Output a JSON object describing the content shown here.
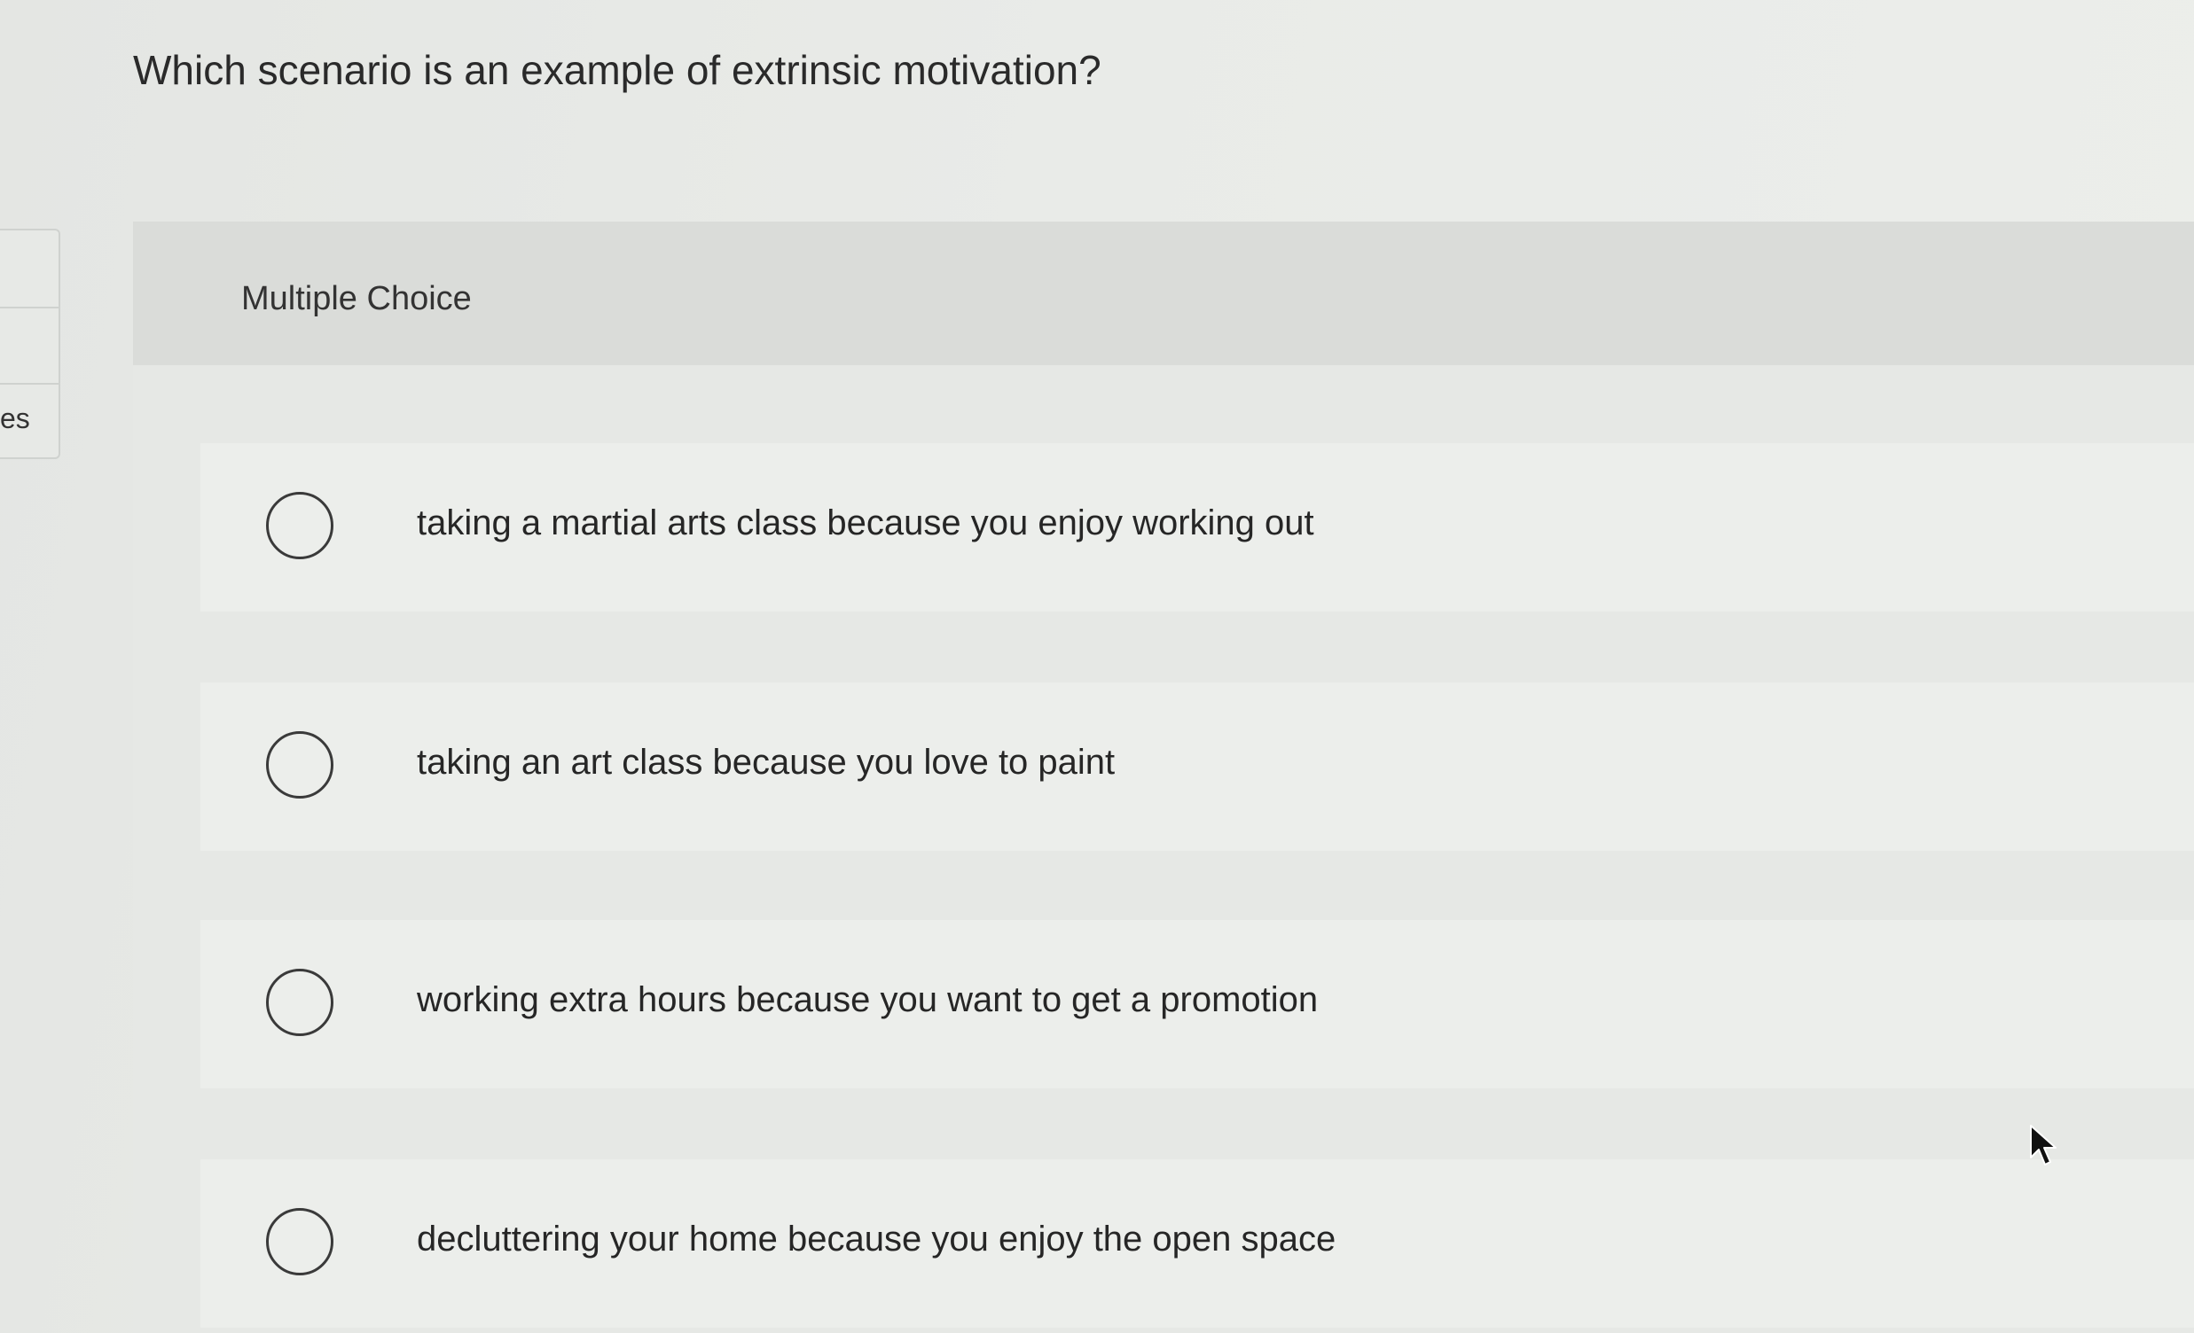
{
  "question": {
    "text": "Which scenario is an example of extrinsic motivation?"
  },
  "sidebar": {
    "partial_tab_text": "es"
  },
  "panel": {
    "title": "Multiple Choice"
  },
  "options": [
    {
      "label": "taking a martial arts class because you enjoy working out",
      "selected": false
    },
    {
      "label": "taking an art class because you love to paint",
      "selected": false
    },
    {
      "label": "working extra hours because you want to get a promotion",
      "selected": false
    },
    {
      "label": "decluttering your home because you enjoy the open space",
      "selected": false
    }
  ],
  "icons": {
    "radio": "radio-circle-icon",
    "cursor": "mouse-pointer-icon"
  },
  "colors": {
    "background": "#e9ebe8",
    "panel_header": "#dadcd9",
    "option_row": "#eceeeb",
    "text": "#262626"
  }
}
